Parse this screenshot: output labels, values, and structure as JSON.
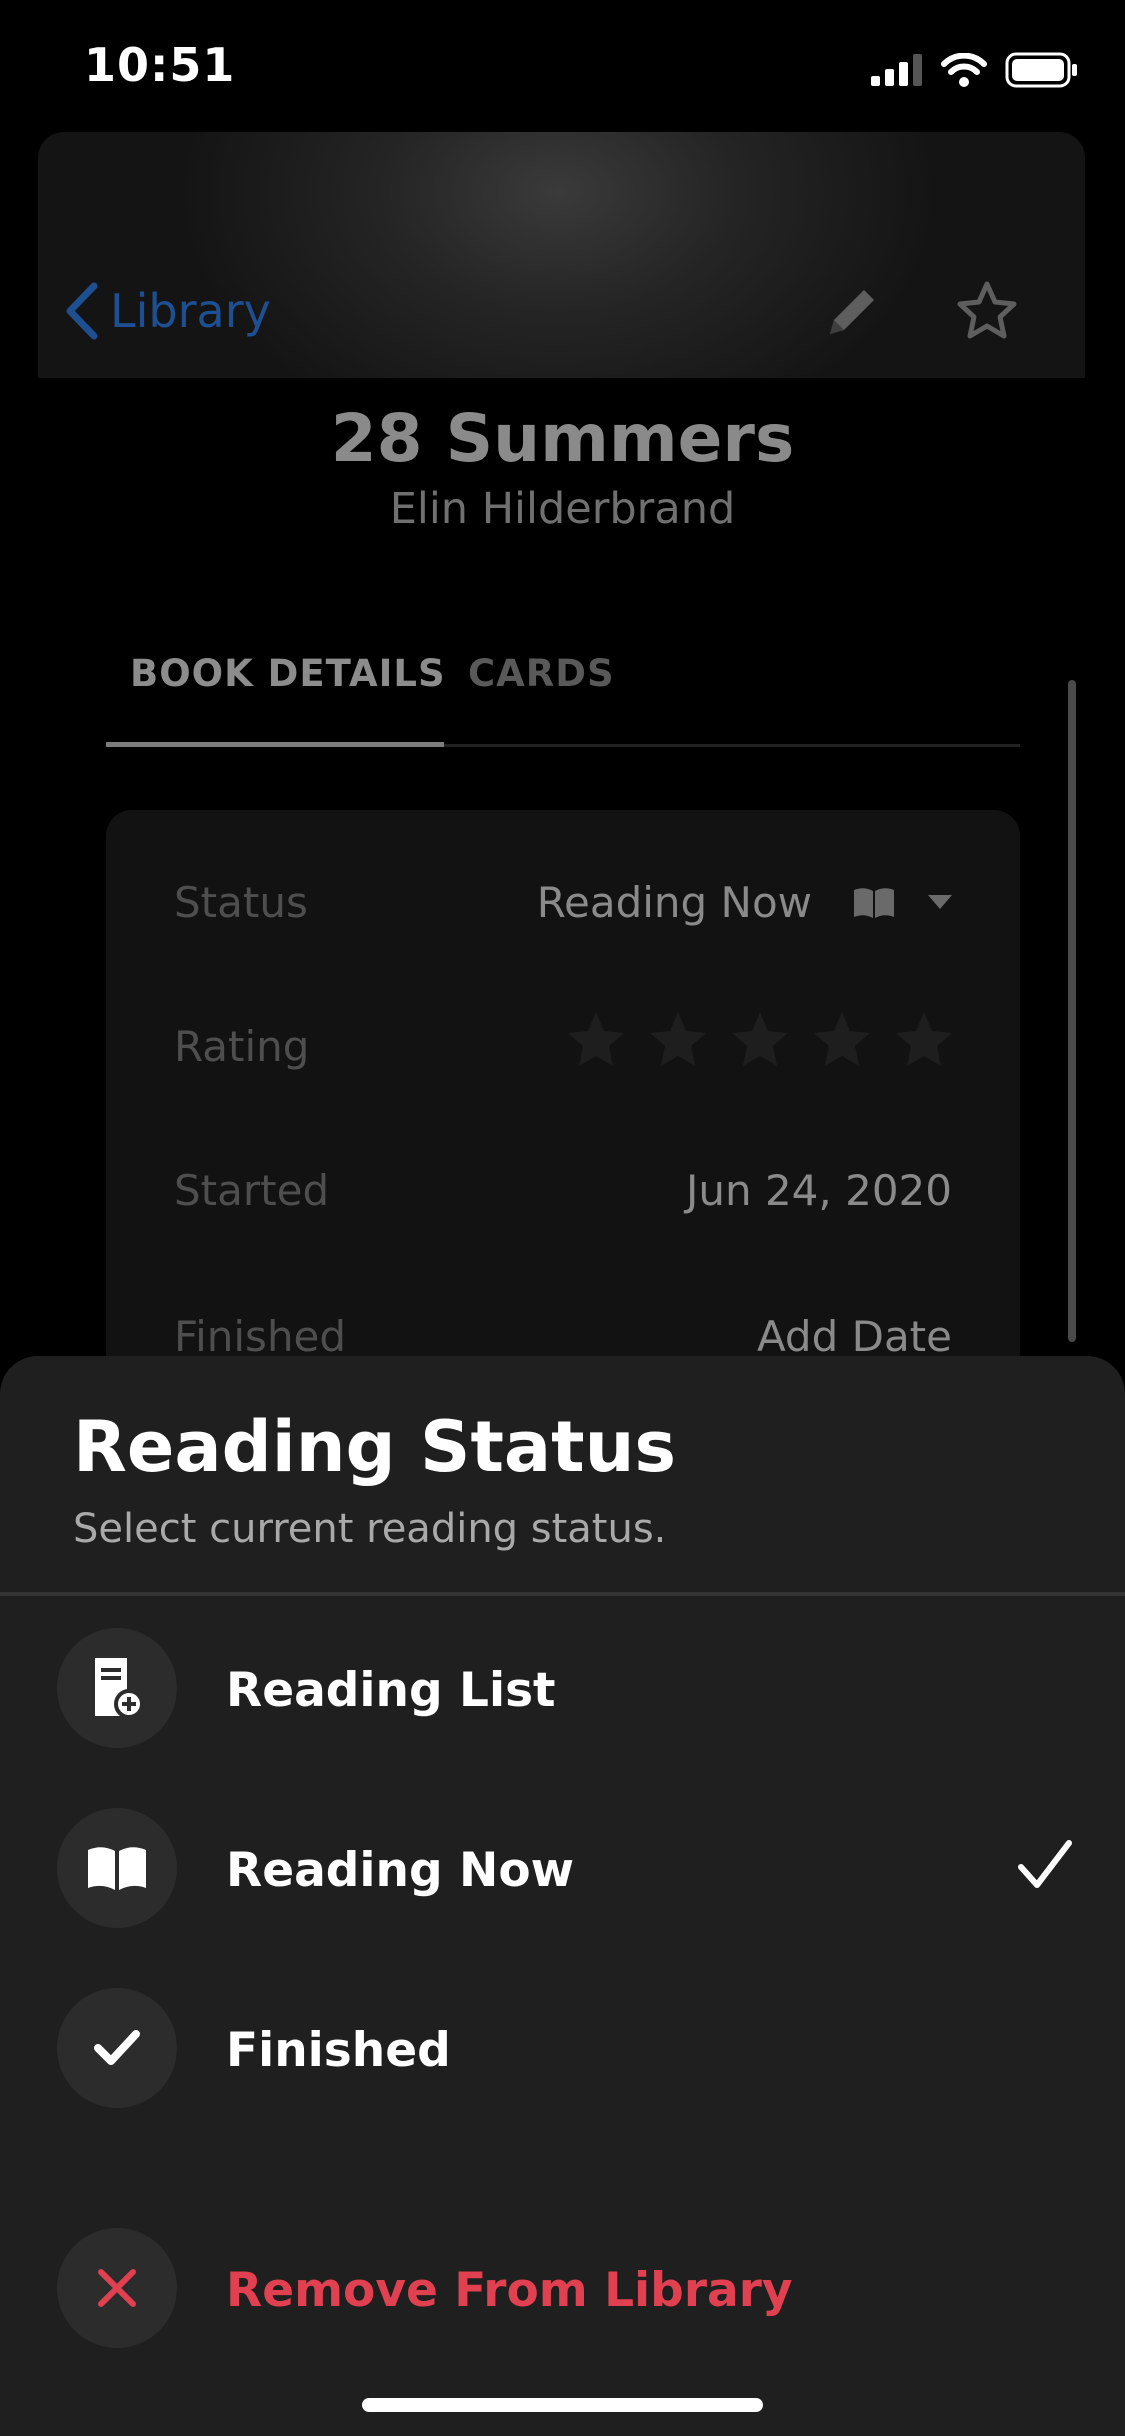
{
  "status_bar": {
    "time": "10:51"
  },
  "nav": {
    "back_label": "Library"
  },
  "book": {
    "title": "28 Summers",
    "author": "Elin Hilderbrand"
  },
  "tabs": [
    {
      "label": "BOOK DETAILS",
      "selected": true
    },
    {
      "label": "CARDS",
      "selected": false
    }
  ],
  "details": {
    "status": {
      "label": "Status",
      "value": "Reading Now"
    },
    "rating": {
      "label": "Rating",
      "stars": 0,
      "max": 5
    },
    "started": {
      "label": "Started",
      "value": "Jun 24, 2020"
    },
    "finished": {
      "label": "Finished",
      "value": "Add Date"
    }
  },
  "sheet": {
    "title": "Reading Status",
    "subtitle": "Select current reading status.",
    "options": [
      {
        "label": "Reading List",
        "icon": "book-add-icon",
        "selected": false
      },
      {
        "label": "Reading Now",
        "icon": "open-book-icon",
        "selected": true
      },
      {
        "label": "Finished",
        "icon": "checkmark-icon",
        "selected": false
      }
    ],
    "remove": {
      "label": "Remove From Library",
      "icon": "x-icon"
    }
  },
  "colors": {
    "accent": "#1d4f91",
    "danger": "#e0404f",
    "sheet_bg": "#1f1f1f"
  }
}
